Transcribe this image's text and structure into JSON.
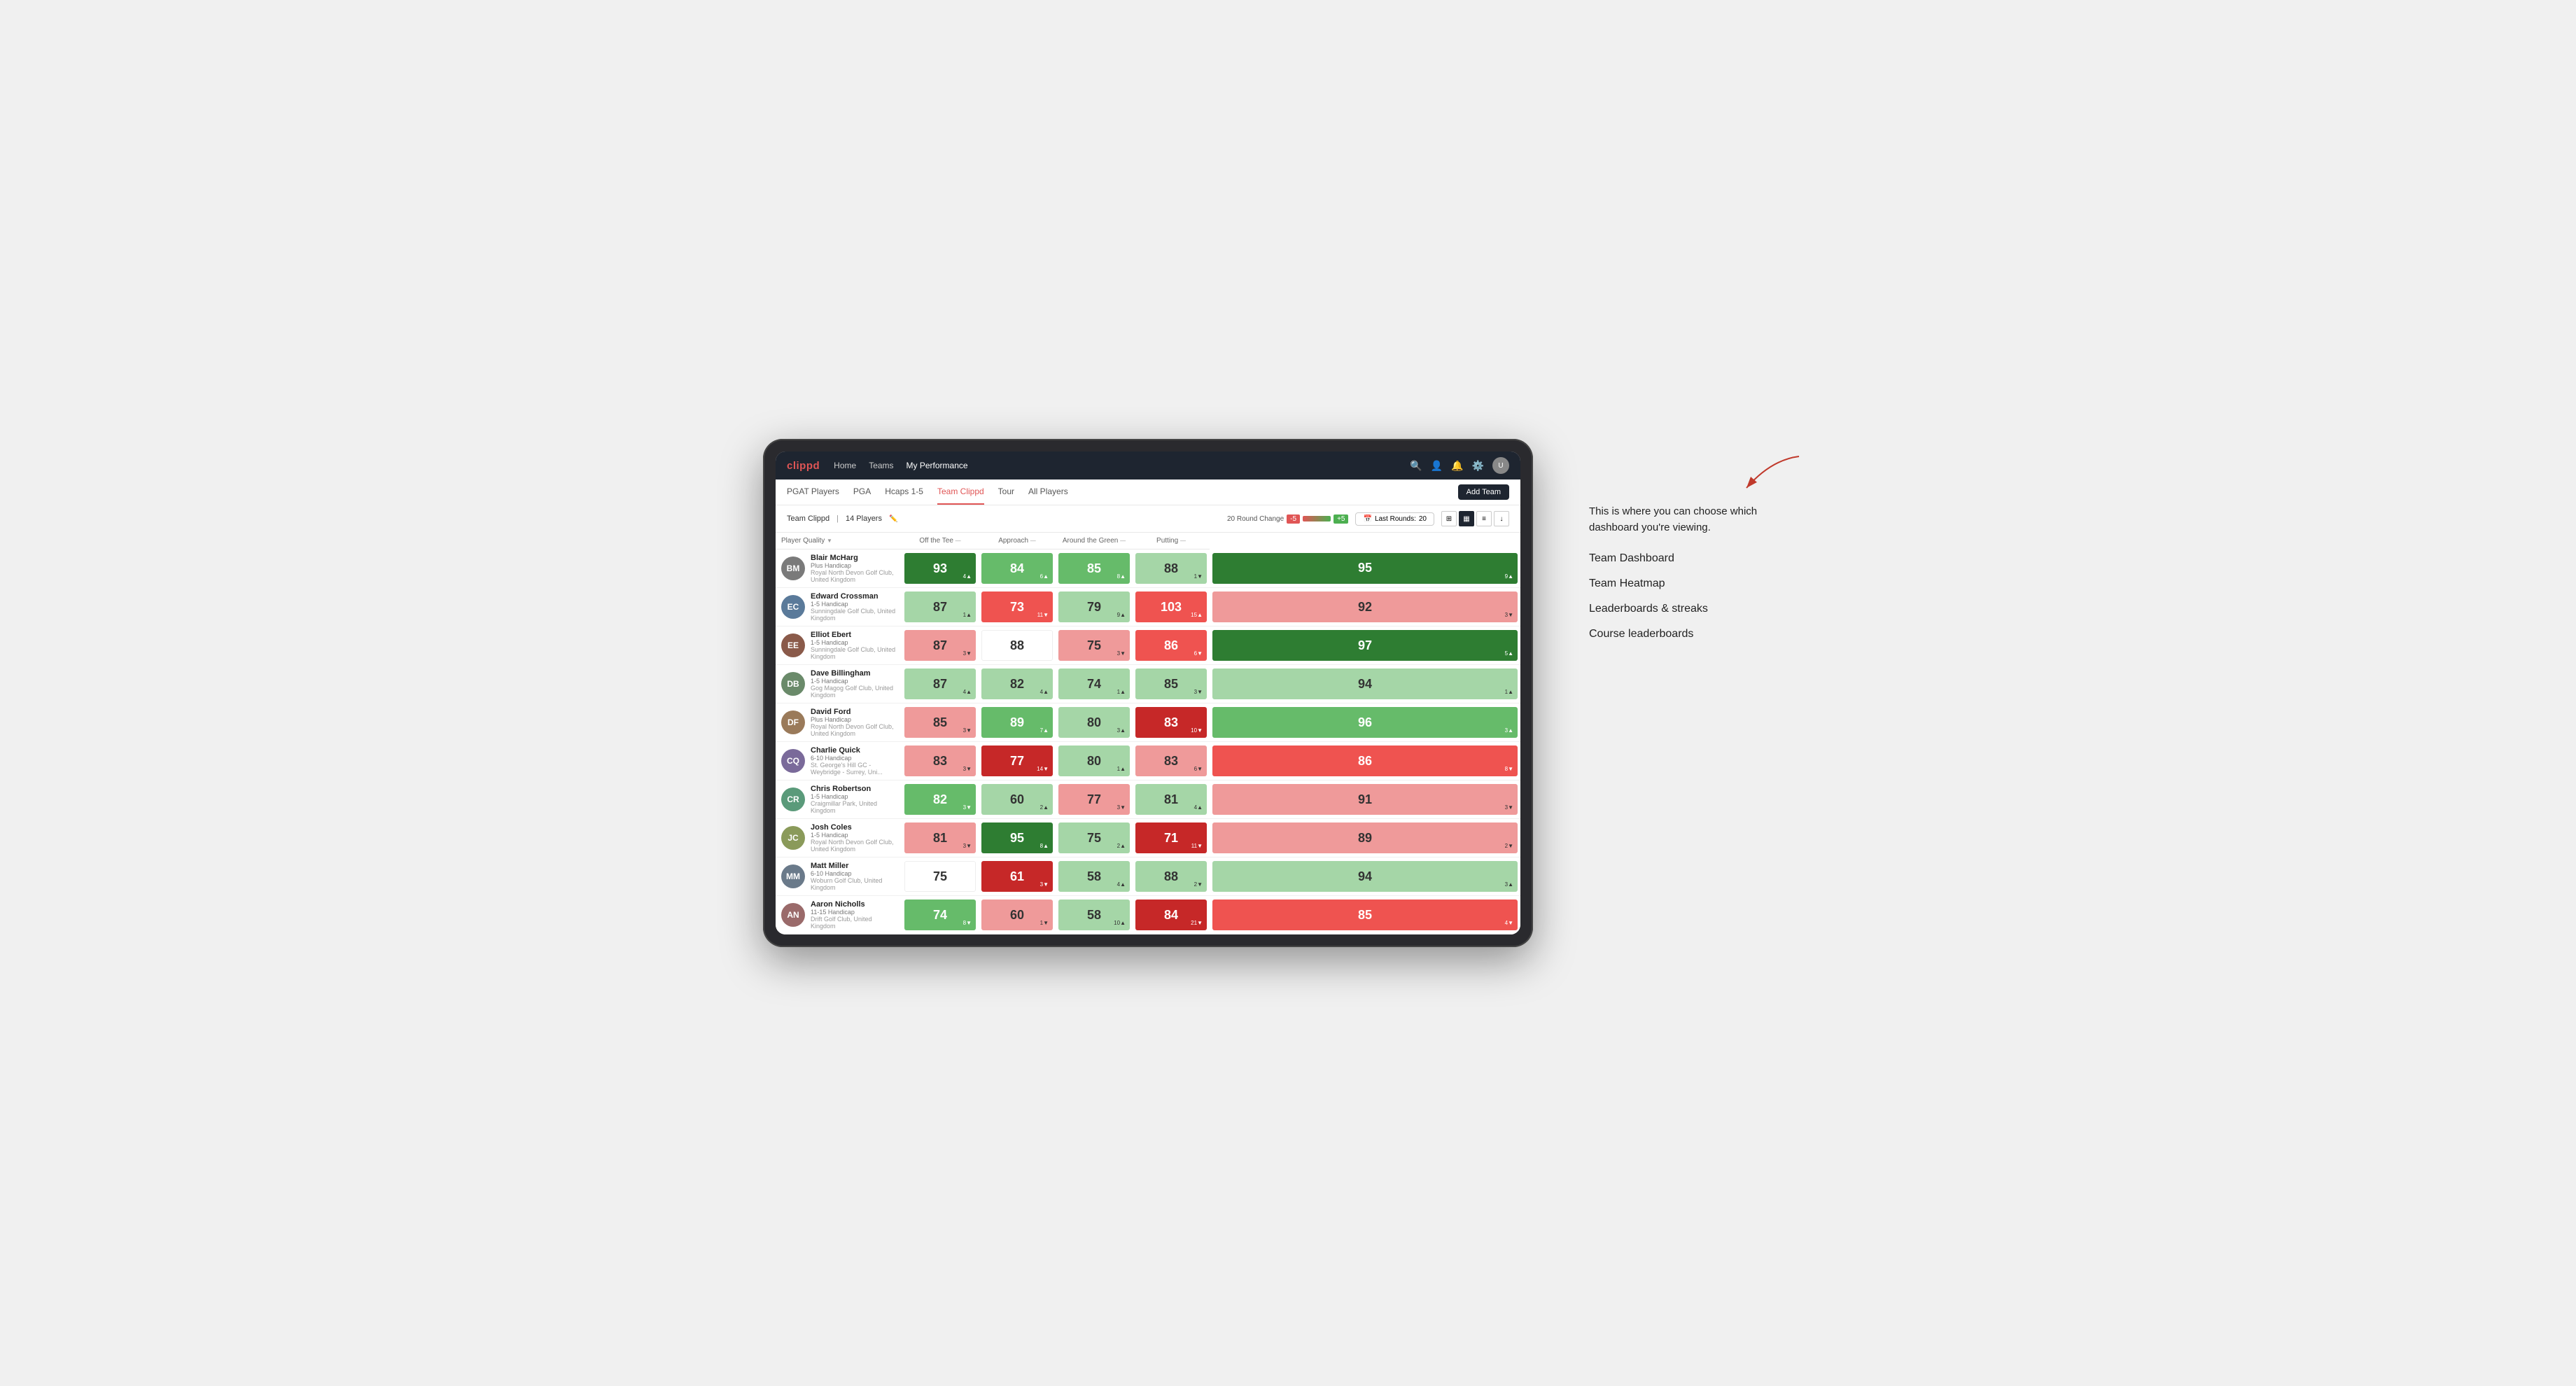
{
  "annotation": {
    "text": "This is where you can choose which dashboard you're viewing.",
    "menu_items": [
      "Team Dashboard",
      "Team Heatmap",
      "Leaderboards & streaks",
      "Course leaderboards"
    ]
  },
  "nav": {
    "logo": "clippd",
    "items": [
      "Home",
      "Teams",
      "My Performance"
    ],
    "active": "My Performance",
    "icons": [
      "search",
      "person",
      "bell",
      "settings",
      "avatar"
    ]
  },
  "secondary_nav": {
    "items": [
      "PGAT Players",
      "PGA",
      "Hcaps 1-5",
      "Team Clippd",
      "Tour",
      "All Players"
    ],
    "active": "Team Clippd",
    "add_team_label": "Add Team"
  },
  "team_header": {
    "team_name": "Team Clippd",
    "player_count": "14 Players",
    "round_change_label": "20 Round Change",
    "badge_minus": "-5",
    "badge_plus": "+5",
    "last_rounds_label": "Last Rounds:",
    "last_rounds_value": "20"
  },
  "table": {
    "columns": [
      {
        "label": "Player Quality",
        "key": "player_quality",
        "has_arrow": true
      },
      {
        "label": "Off the Tee",
        "key": "off_tee",
        "has_arrow": true
      },
      {
        "label": "Approach",
        "key": "approach",
        "has_arrow": true
      },
      {
        "label": "Around the Green",
        "key": "around_green",
        "has_arrow": true
      },
      {
        "label": "Putting",
        "key": "putting",
        "has_arrow": true
      }
    ],
    "rows": [
      {
        "name": "Blair McHarg",
        "hcap": "Plus Handicap",
        "club": "Royal North Devon Golf Club, United Kingdom",
        "initials": "BM",
        "color": "#7a7a7a",
        "player_quality": {
          "val": 93,
          "change": "+4",
          "dir": "up",
          "style": "green-dark"
        },
        "off_tee": {
          "val": 84,
          "change": "+6",
          "dir": "up",
          "style": "green-mid"
        },
        "approach": {
          "val": 85,
          "change": "+8",
          "dir": "up",
          "style": "green-mid"
        },
        "around_green": {
          "val": 88,
          "change": "-1",
          "dir": "down",
          "style": "green-light"
        },
        "putting": {
          "val": 95,
          "change": "+9",
          "dir": "up",
          "style": "green-dark"
        }
      },
      {
        "name": "Edward Crossman",
        "hcap": "1-5 Handicap",
        "club": "Sunningdale Golf Club, United Kingdom",
        "initials": "EC",
        "color": "#5a7a9a",
        "player_quality": {
          "val": 87,
          "change": "+1",
          "dir": "up",
          "style": "green-light"
        },
        "off_tee": {
          "val": 73,
          "change": "-11",
          "dir": "down",
          "style": "red-mid"
        },
        "approach": {
          "val": 79,
          "change": "+9",
          "dir": "up",
          "style": "green-light"
        },
        "around_green": {
          "val": 103,
          "change": "+15",
          "dir": "up",
          "style": "red-mid"
        },
        "putting": {
          "val": 92,
          "change": "-3",
          "dir": "down",
          "style": "red-light"
        }
      },
      {
        "name": "Elliot Ebert",
        "hcap": "1-5 Handicap",
        "club": "Sunningdale Golf Club, United Kingdom",
        "initials": "EE",
        "color": "#8a5a4a",
        "player_quality": {
          "val": 87,
          "change": "-3",
          "dir": "down",
          "style": "red-light"
        },
        "off_tee": {
          "val": 88,
          "change": "",
          "dir": "",
          "style": "white-bg"
        },
        "approach": {
          "val": 75,
          "change": "-3",
          "dir": "down",
          "style": "red-light"
        },
        "around_green": {
          "val": 86,
          "change": "-6",
          "dir": "down",
          "style": "red-mid"
        },
        "putting": {
          "val": 97,
          "change": "+5",
          "dir": "up",
          "style": "green-dark"
        }
      },
      {
        "name": "Dave Billingham",
        "hcap": "1-5 Handicap",
        "club": "Gog Magog Golf Club, United Kingdom",
        "initials": "DB",
        "color": "#6a8a6a",
        "player_quality": {
          "val": 87,
          "change": "+4",
          "dir": "up",
          "style": "green-light"
        },
        "off_tee": {
          "val": 82,
          "change": "+4",
          "dir": "up",
          "style": "green-light"
        },
        "approach": {
          "val": 74,
          "change": "+1",
          "dir": "up",
          "style": "green-light"
        },
        "around_green": {
          "val": 85,
          "change": "-3",
          "dir": "down",
          "style": "green-light"
        },
        "putting": {
          "val": 94,
          "change": "+1",
          "dir": "up",
          "style": "green-light"
        }
      },
      {
        "name": "David Ford",
        "hcap": "Plus Handicap",
        "club": "Royal North Devon Golf Club, United Kingdom",
        "initials": "DF",
        "color": "#9a7a5a",
        "player_quality": {
          "val": 85,
          "change": "-3",
          "dir": "down",
          "style": "red-light"
        },
        "off_tee": {
          "val": 89,
          "change": "+7",
          "dir": "up",
          "style": "green-mid"
        },
        "approach": {
          "val": 80,
          "change": "+3",
          "dir": "up",
          "style": "green-light"
        },
        "around_green": {
          "val": 83,
          "change": "-10",
          "dir": "down",
          "style": "red-dark"
        },
        "putting": {
          "val": 96,
          "change": "+3",
          "dir": "up",
          "style": "green-mid"
        }
      },
      {
        "name": "Charlie Quick",
        "hcap": "6-10 Handicap",
        "club": "St. George's Hill GC - Weybridge - Surrey, Uni...",
        "initials": "CQ",
        "color": "#7a6a9a",
        "player_quality": {
          "val": 83,
          "change": "-3",
          "dir": "down",
          "style": "red-light"
        },
        "off_tee": {
          "val": 77,
          "change": "-14",
          "dir": "down",
          "style": "red-dark"
        },
        "approach": {
          "val": 80,
          "change": "+1",
          "dir": "up",
          "style": "green-light"
        },
        "around_green": {
          "val": 83,
          "change": "-6",
          "dir": "down",
          "style": "red-light"
        },
        "putting": {
          "val": 86,
          "change": "-8",
          "dir": "down",
          "style": "red-mid"
        }
      },
      {
        "name": "Chris Robertson",
        "hcap": "1-5 Handicap",
        "club": "Craigmillar Park, United Kingdom",
        "initials": "CR",
        "color": "#5a9a7a",
        "player_quality": {
          "val": 82,
          "change": "-3",
          "dir": "down",
          "style": "green-mid"
        },
        "off_tee": {
          "val": 60,
          "change": "+2",
          "dir": "up",
          "style": "green-light"
        },
        "approach": {
          "val": 77,
          "change": "-3",
          "dir": "down",
          "style": "red-light"
        },
        "around_green": {
          "val": 81,
          "change": "+4",
          "dir": "up",
          "style": "green-light"
        },
        "putting": {
          "val": 91,
          "change": "-3",
          "dir": "down",
          "style": "red-light"
        }
      },
      {
        "name": "Josh Coles",
        "hcap": "1-5 Handicap",
        "club": "Royal North Devon Golf Club, United Kingdom",
        "initials": "JC",
        "color": "#8a9a5a",
        "player_quality": {
          "val": 81,
          "change": "-3",
          "dir": "down",
          "style": "red-light"
        },
        "off_tee": {
          "val": 95,
          "change": "+8",
          "dir": "up",
          "style": "green-dark"
        },
        "approach": {
          "val": 75,
          "change": "+2",
          "dir": "up",
          "style": "green-light"
        },
        "around_green": {
          "val": 71,
          "change": "-11",
          "dir": "down",
          "style": "red-dark"
        },
        "putting": {
          "val": 89,
          "change": "-2",
          "dir": "down",
          "style": "red-light"
        }
      },
      {
        "name": "Matt Miller",
        "hcap": "6-10 Handicap",
        "club": "Woburn Golf Club, United Kingdom",
        "initials": "MM",
        "color": "#6a7a8a",
        "player_quality": {
          "val": 75,
          "change": "",
          "dir": "",
          "style": "white-bg"
        },
        "off_tee": {
          "val": 61,
          "change": "-3",
          "dir": "down",
          "style": "red-dark"
        },
        "approach": {
          "val": 58,
          "change": "+4",
          "dir": "up",
          "style": "green-light"
        },
        "around_green": {
          "val": 88,
          "change": "-2",
          "dir": "down",
          "style": "green-light"
        },
        "putting": {
          "val": 94,
          "change": "+3",
          "dir": "up",
          "style": "green-light"
        }
      },
      {
        "name": "Aaron Nicholls",
        "hcap": "11-15 Handicap",
        "club": "Drift Golf Club, United Kingdom",
        "initials": "AN",
        "color": "#9a6a6a",
        "player_quality": {
          "val": 74,
          "change": "-8",
          "dir": "down",
          "style": "green-mid"
        },
        "off_tee": {
          "val": 60,
          "change": "-1",
          "dir": "down",
          "style": "red-light"
        },
        "approach": {
          "val": 58,
          "change": "+10",
          "dir": "up",
          "style": "green-light"
        },
        "around_green": {
          "val": 84,
          "change": "-21",
          "dir": "down",
          "style": "red-dark"
        },
        "putting": {
          "val": 85,
          "change": "-4",
          "dir": "down",
          "style": "red-mid"
        }
      }
    ]
  }
}
